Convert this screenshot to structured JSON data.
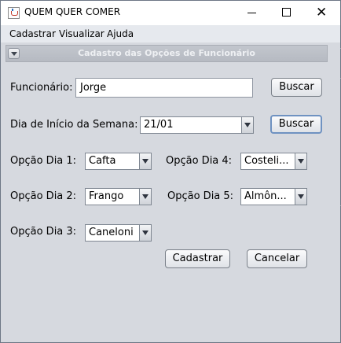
{
  "window": {
    "title": "QUEM QUER COMER"
  },
  "menu": {
    "items": [
      "Cadastrar",
      "Visualizar",
      "Ajuda"
    ]
  },
  "panel": {
    "title": "Cadastro das Opções de Funcionário"
  },
  "form": {
    "funcionario_label": "Funcionário:",
    "funcionario_value": "Jorge",
    "buscar1_label": "Buscar",
    "inicio_label": "Dia de Início da Semana:",
    "inicio_value": "21/01",
    "buscar2_label": "Buscar",
    "opcao1_label": "Opção Dia 1:",
    "opcao1_value": "Cafta",
    "opcao2_label": "Opção Dia 2:",
    "opcao2_value": "Frango",
    "opcao3_label": "Opção Dia 3:",
    "opcao3_value": "Caneloni",
    "opcao4_label": "Opção Dia 4:",
    "opcao4_value": "Costeli...",
    "opcao5_label": "Opção Dia 5:",
    "opcao5_value": "Almôn...",
    "cadastrar_label": "Cadastrar",
    "cancelar_label": "Cancelar"
  },
  "colors": {
    "window_bg": "#d6d9df",
    "panel_header": "#b9bdc5",
    "focus_border": "#6f92c1"
  }
}
